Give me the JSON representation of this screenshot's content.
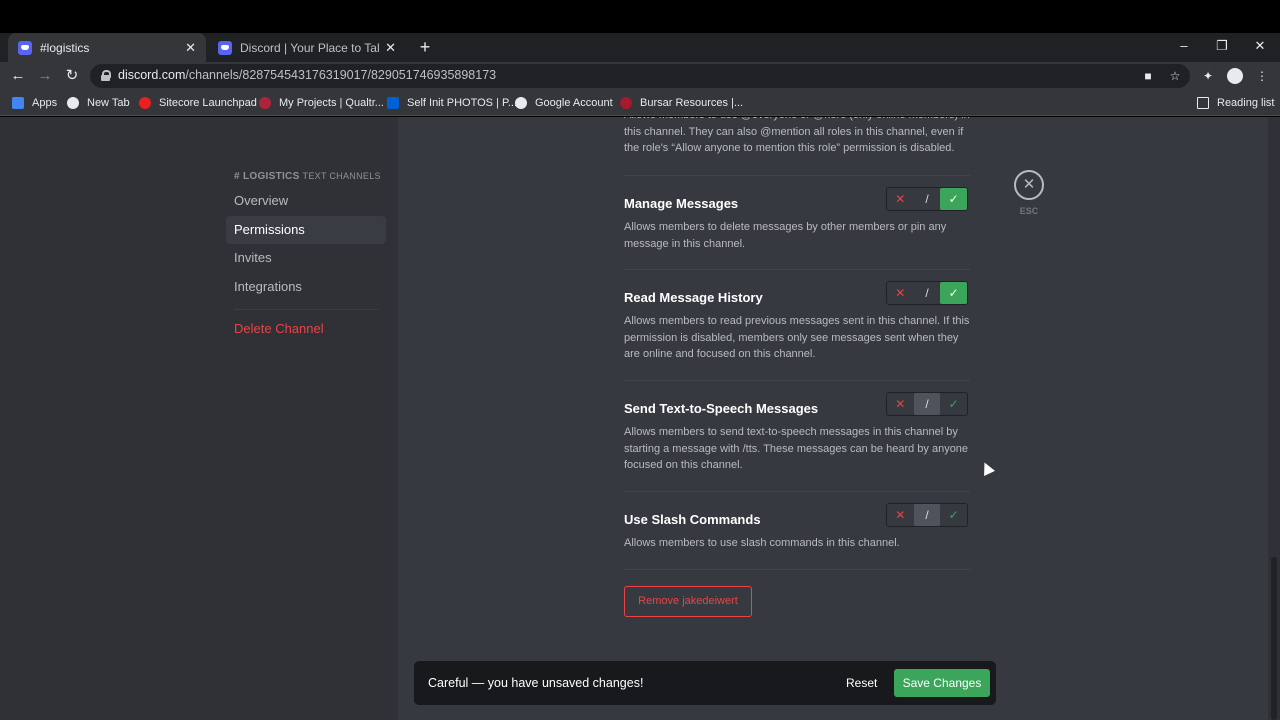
{
  "browser": {
    "tabs": [
      {
        "title": "#logistics"
      },
      {
        "title": "Discord | Your Place to Talk and Hang Out"
      }
    ],
    "close_glyph": "✕",
    "newtab_glyph": "+",
    "url_host": "discord.com",
    "url_path": "/channels/828754543176319017/829051746935898173",
    "bookmarks": [
      "Apps",
      "New Tab",
      "Sitecore Launchpad",
      "My Projects | Qualtr...",
      "Self Init PHOTOS | P...",
      "Google Account",
      "Bursar Resources |..."
    ],
    "reading_list": "Reading list"
  },
  "sidebar": {
    "channel": "LOGISTICS",
    "category": "TEXT CHANNELS",
    "items": [
      {
        "label": "Overview"
      },
      {
        "label": "Permissions"
      },
      {
        "label": "Invites"
      },
      {
        "label": "Integrations"
      }
    ],
    "delete": "Delete Channel"
  },
  "truncated_text": "Allows members to use @everyone or @here (only online members) in this channel. They can also @mention all roles in this channel, even if the role's “Allow anyone to mention this role” permission is disabled.",
  "permissions": [
    {
      "title": "Manage Messages",
      "description": "Allows members to delete messages by other members or pin any message in this channel.",
      "state": "allow"
    },
    {
      "title": "Read Message History",
      "description": "Allows members to read previous messages sent in this channel. If this permission is disabled, members only see messages sent when they are online and focused on this channel.",
      "state": "allow"
    },
    {
      "title": "Send Text-to-Speech Messages",
      "description": "Allows members to send text-to-speech messages in this channel by starting a message with /tts. These messages can be heard by anyone focused on this channel.",
      "state": "neutral"
    },
    {
      "title": "Use Slash Commands",
      "description": "Allows members to use slash commands in this channel.",
      "state": "neutral"
    }
  ],
  "toggle_glyphs": {
    "deny": "✕",
    "neutral": "/",
    "allow": "✓"
  },
  "remove_button": "Remove jakedeiwert",
  "close": {
    "glyph": "✕",
    "label": "ESC"
  },
  "notice": {
    "text": "Careful — you have unsaved changes!",
    "reset": "Reset",
    "save": "Save Changes"
  },
  "colors": {
    "accent_green": "#3ba55c",
    "danger_red": "#ed4245",
    "blurple": "#5865f2"
  }
}
